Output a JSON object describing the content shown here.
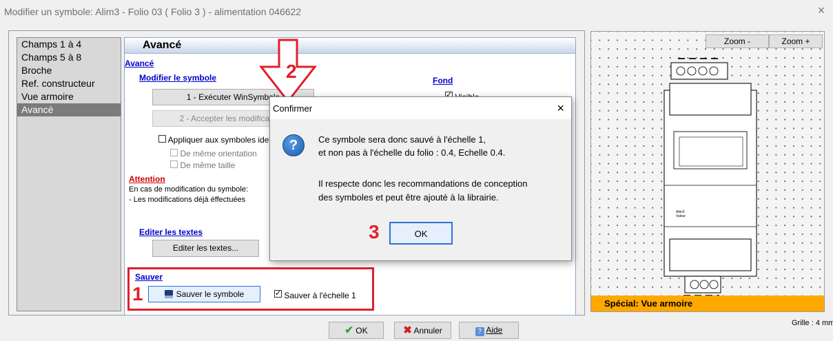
{
  "window": {
    "title": "Modifier un symbole: Alim3 - Folio 03 ( Folio 3 ) - alimentation 046622"
  },
  "nav": {
    "items": [
      "Champs 1 à 4",
      "Champs 5 à 8",
      "Broche",
      "Ref. constructeur",
      "Vue armoire",
      "Avancé"
    ],
    "selected": 5
  },
  "panel": {
    "title": "Avancé",
    "section_link": "Avancé",
    "modify_label": "Modifier le symbole",
    "exec_btn": "1 - Exécuter WinSymbole",
    "accept_btn": "2 - Accepter les modifications",
    "apply_same": "Appliquer aux symboles identiques",
    "same_orientation": "De même orientation",
    "same_size": "De même taille",
    "fond_label": "Fond",
    "fond_visible": "Visible",
    "attention_label": "Attention",
    "attention_line1": "En cas de modification du symbole:",
    "attention_line2": "- Les modifications déjà éffectuées",
    "edit_texts_label": "Editer les textes",
    "edit_texts_btn": "Editer les textes...",
    "save_label": "Sauver",
    "save_btn": "Sauver le symbole",
    "save_scale": "Sauver à l'échelle 1"
  },
  "annotations": {
    "n1": "1",
    "n2": "2",
    "n3": "3"
  },
  "dialog": {
    "title": "Confirmer",
    "line1": "Ce symbole sera donc sauvé à l'échelle 1,",
    "line2": "et non pas à l'échelle du folio : 0.4, Echelle 0.4.",
    "line3": "Il respecte donc les recommandations de conception",
    "line4": "des symboles et peut être ajouté à la librairie.",
    "ok": "OK"
  },
  "preview": {
    "zoom_out": "Zoom -",
    "zoom_in": "Zoom +",
    "footer": "Spécial: Vue armoire",
    "footer_color": "#ffa800",
    "label1": "Alim3",
    "label2": "Valeur",
    "grid": "Grille : 4 mm"
  },
  "footer": {
    "ok": "OK",
    "cancel": "Annuler",
    "help": "Aide"
  }
}
